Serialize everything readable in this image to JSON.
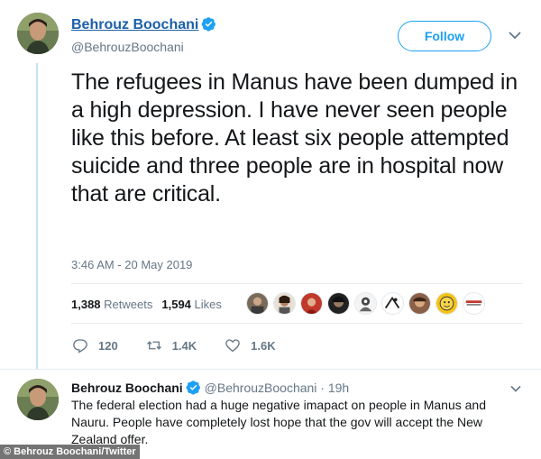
{
  "tweet": {
    "author_name": "Behrouz Boochani",
    "author_handle": "@BehrouzBoochani",
    "follow_label": "Follow",
    "text": "The refugees in Manus have been dumped in a high depression. I have never seen people like this before. At least six people attempted suicide and three people are in hospital now that are critical.",
    "timestamp": "3:46 AM - 20 May 2019",
    "retweets_count": "1,388",
    "retweets_label": "Retweets",
    "likes_count": "1,594",
    "likes_label": "Likes",
    "replies_action": "120",
    "retweets_action": "1.4K",
    "likes_action": "1.6K"
  },
  "reply": {
    "author_name": "Behrouz Boochani",
    "author_handle": "@BehrouzBoochani · 19h",
    "text": "The federal election had a huge negative imapact on people in Manus and Nauru. People have completely lost hope that the gov will accept the New Zealand offer."
  },
  "credit": "© Behrouz Boochani/Twitter",
  "icons": {
    "verified": "verified-badge-icon",
    "chevron": "chevron-down-icon",
    "reply": "reply-icon",
    "retweet": "retweet-icon",
    "like": "heart-icon"
  },
  "colors": {
    "accent": "#1da1f2",
    "name_link": "#1b5fa8",
    "muted": "#657786",
    "thread_line": "#c4e3f5"
  }
}
